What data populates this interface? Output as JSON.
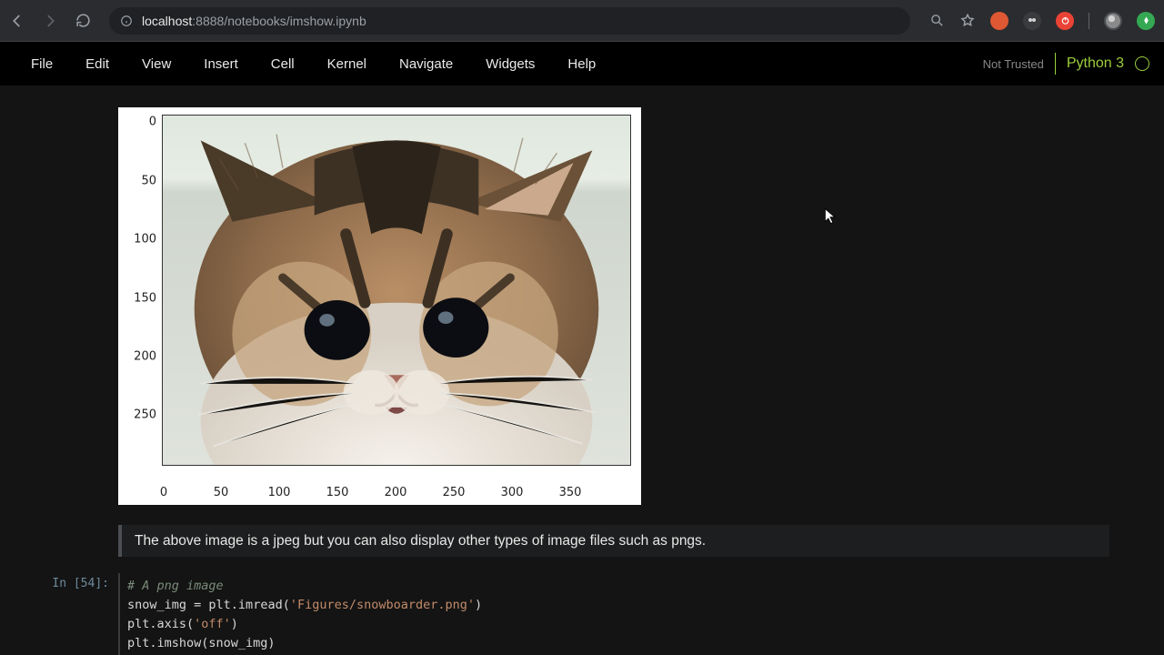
{
  "browser": {
    "url_host": "localhost",
    "url_port": ":8888",
    "url_path": "/notebooks/imshow.ipynb"
  },
  "menu": {
    "items": [
      "File",
      "Edit",
      "View",
      "Insert",
      "Cell",
      "Kernel",
      "Navigate",
      "Widgets",
      "Help"
    ],
    "not_trusted": "Not Trusted",
    "kernel": "Python 3"
  },
  "figure": {
    "y_ticks": [
      "0",
      "50",
      "100",
      "150",
      "200",
      "250"
    ],
    "x_ticks": [
      "0",
      "50",
      "100",
      "150",
      "200",
      "250",
      "300",
      "350"
    ]
  },
  "markdown": {
    "text": "The above image is a jpeg but you can also display other types of image files such as pngs."
  },
  "code_cell": {
    "prompt": "In [54]:",
    "lines": {
      "l1_comment": "# A png image",
      "l2_var": "snow_img ",
      "l2_op": "= ",
      "l2_call": "plt.imread(",
      "l2_str": "'Figures/snowboarder.png'",
      "l2_close": ")",
      "l3_call": "plt.axis(",
      "l3_str": "'off'",
      "l3_close": ")",
      "l4": "plt.imshow(snow_img)"
    }
  }
}
